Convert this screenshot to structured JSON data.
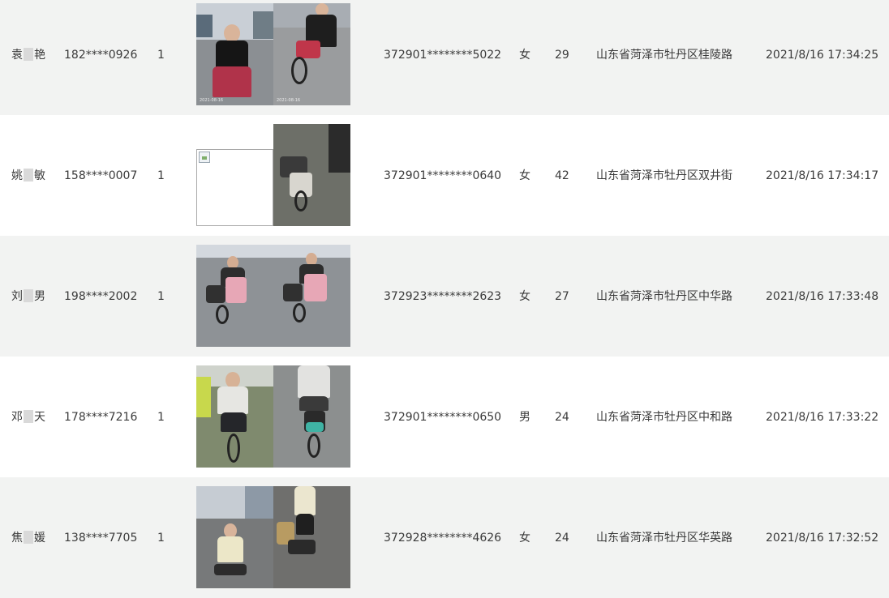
{
  "rows": [
    {
      "name_first": "袁",
      "name_last": "艳",
      "phone": "182****0926",
      "count": "1",
      "id_number": "372901********5022",
      "gender": "女",
      "age": "29",
      "address": "山东省菏泽市牡丹区桂陵路",
      "time": "2021/8/16 17:34:25",
      "photo_left": "photo",
      "photo_right": "photo"
    },
    {
      "name_first": "姚",
      "name_last": "敏",
      "phone": "158****0007",
      "count": "1",
      "id_number": "372901********0640",
      "gender": "女",
      "age": "42",
      "address": "山东省菏泽市牡丹区双井街",
      "time": "2021/8/16 17:34:17",
      "photo_left": "broken",
      "photo_right": "photo"
    },
    {
      "name_first": "刘",
      "name_last": "男",
      "phone": "198****2002",
      "count": "1",
      "id_number": "372923********2623",
      "gender": "女",
      "age": "27",
      "address": "山东省菏泽市牡丹区中华路",
      "time": "2021/8/16 17:33:48",
      "photo_left": "photo",
      "photo_right": "photo"
    },
    {
      "name_first": "邓",
      "name_last": "天",
      "phone": "178****7216",
      "count": "1",
      "id_number": "372901********0650",
      "gender": "男",
      "age": "24",
      "address": "山东省菏泽市牡丹区中和路",
      "time": "2021/8/16 17:33:22",
      "photo_left": "photo",
      "photo_right": "photo"
    },
    {
      "name_first": "焦",
      "name_last": "媛",
      "phone": "138****7705",
      "count": "1",
      "id_number": "372928********4626",
      "gender": "女",
      "age": "24",
      "address": "山东省菏泽市牡丹区华英路",
      "time": "2021/8/16 17:32:52",
      "photo_left": "photo",
      "photo_right": "photo"
    }
  ],
  "colors": {
    "row_odd": "#f2f3f2",
    "row_even": "#ffffff",
    "text": "#3a3a3a"
  }
}
